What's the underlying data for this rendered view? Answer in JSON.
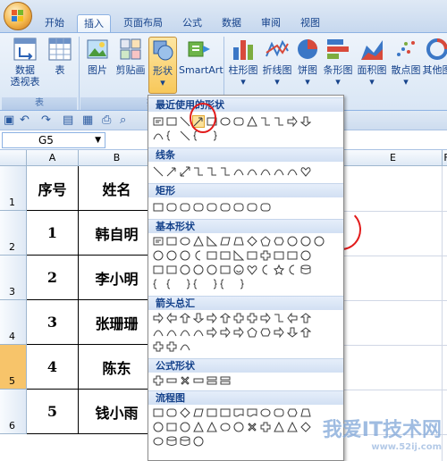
{
  "tabs": [
    "开始",
    "插入",
    "页面布局",
    "公式",
    "数据",
    "审阅",
    "视图"
  ],
  "active_tab": "插入",
  "ribbon": {
    "pivot_label_1": "数据",
    "pivot_label_2": "透视表",
    "table_label": "表",
    "group_table": "表",
    "picture_label": "图片",
    "clipart_label": "剪贴画",
    "shapes_label": "形状",
    "smartart_label": "SmartArt",
    "group_illustrations": "插",
    "charts": [
      "柱形图",
      "折线图",
      "饼图",
      "条形图",
      "面积图",
      "散点图",
      "其他图"
    ]
  },
  "namebox_value": "G5",
  "sheet": {
    "columns": [
      "A",
      "B",
      "E",
      "F"
    ],
    "rows": [
      "1",
      "2",
      "3",
      "4",
      "5",
      "6"
    ],
    "header": {
      "no": "序号",
      "name": "姓名"
    },
    "data": [
      {
        "no": "1",
        "name": "韩自明"
      },
      {
        "no": "2",
        "name": "李小明"
      },
      {
        "no": "3",
        "name": "张珊珊"
      },
      {
        "no": "4",
        "name": "陈东"
      },
      {
        "no": "5",
        "name": "钱小雨"
      }
    ]
  },
  "shapes_menu": {
    "recent": "最近使用的形状",
    "lines": "线条",
    "rectangles": "矩形",
    "basic": "基本形状",
    "arrows": "箭头总汇",
    "equation": "公式形状",
    "flowchart": "流程图"
  },
  "watermark": {
    "text": "我爱IT技术网",
    "url": "www.52ij.com"
  },
  "colors": {
    "accent": "#15428b",
    "ribbon": "#dfe9f5",
    "highlight": "#fbe19a",
    "annotation": "#e21b1b"
  }
}
